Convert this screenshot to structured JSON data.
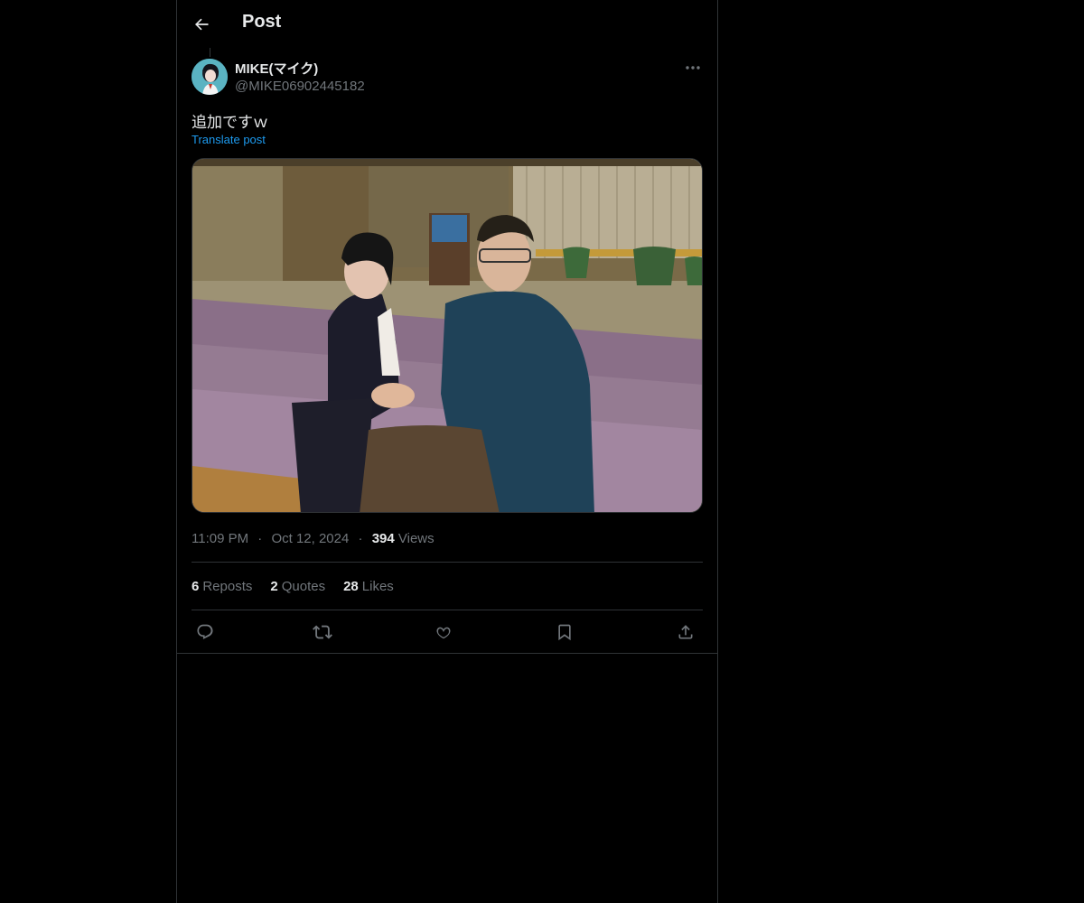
{
  "header": {
    "title": "Post"
  },
  "post": {
    "author": {
      "display_name": "MIKE(マイク)",
      "handle": "@MIKE06902445182"
    },
    "text": "追加ですｗ",
    "translate_label": "Translate post",
    "time": "11:09 PM",
    "date": "Oct 12, 2024",
    "separator": "·",
    "views_count": "394",
    "views_label": "Views",
    "stats": [
      {
        "count": "6",
        "label": "Reposts"
      },
      {
        "count": "2",
        "label": "Quotes"
      },
      {
        "count": "28",
        "label": "Likes"
      }
    ],
    "actions": [
      "reply-icon",
      "repost-icon",
      "like-icon",
      "bookmark-icon",
      "share-icon"
    ]
  },
  "colors": {
    "background": "#000000",
    "text_primary": "#e7e9ea",
    "text_secondary": "#71767b",
    "link": "#1d9bf0",
    "border": "#2f3336"
  }
}
